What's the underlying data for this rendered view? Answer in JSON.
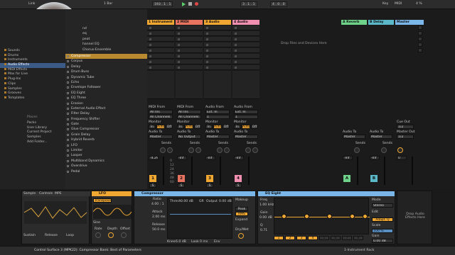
{
  "transport": {
    "link": "Link",
    "bpm_label": "1 Bar",
    "pos": "193 . 1 . 1",
    "pos2": "3 . 1 . 1",
    "end": "4 . 0 . 0",
    "key": "Key",
    "midi": "MIDI",
    "cpu": "4 %"
  },
  "browser": {
    "categories": [
      {
        "label": "Sounds",
        "color": "#b07a2e"
      },
      {
        "label": "Drums",
        "color": "#b07a2e"
      },
      {
        "label": "Instruments",
        "color": "#b07a2e"
      },
      {
        "label": "Audio Effects",
        "color": "#b07a2e"
      },
      {
        "label": "MIDI Effects",
        "color": "#b07a2e"
      },
      {
        "label": "Max for Live",
        "color": "#b07a2e"
      },
      {
        "label": "Plug-Ins",
        "color": "#b07a2e"
      },
      {
        "label": "Clips",
        "color": "#b07a2e"
      },
      {
        "label": "Samples",
        "color": "#b07a2e"
      },
      {
        "label": "Grooves",
        "color": "#b07a2e"
      },
      {
        "label": "Templates",
        "color": "#b07a2e"
      }
    ],
    "selected_category": 3,
    "places_title": "Places",
    "places": [
      "Packs",
      "User Library",
      "Current Project",
      "Samples",
      "Add Folder..."
    ],
    "items_top": [
      "nd",
      "eq",
      "peat",
      "hannel EQ",
      "Chorus-Ensemble"
    ],
    "items": [
      "Compressor",
      "Corpus",
      "Delay",
      "Drum Buss",
      "Dynamic Tube",
      "Echo",
      "Envelope Follower",
      "EQ Eight",
      "EQ Three",
      "Erosion",
      "External Audio Effect",
      "Filter Delay",
      "Frequency Shifter",
      "Gate",
      "Glue Compressor",
      "Grain Delay",
      "Hybrid Reverb",
      "LFO",
      "Limiter",
      "Looper",
      "Multiband Dynamics",
      "Overdrive",
      "Pedal"
    ],
    "selected_item": 0
  },
  "tracks": [
    {
      "name": "1 Instrument",
      "color": "#f0a832"
    },
    {
      "name": "2 MIDI",
      "color": "#e8735e"
    },
    {
      "name": "3 Audio",
      "color": "#f0a832"
    },
    {
      "name": "4 Audio",
      "color": "#f08fb0"
    }
  ],
  "returns": [
    {
      "name": "A Reverb",
      "color": "#6fd28a"
    },
    {
      "name": "B Delay",
      "color": "#5ab8c8"
    }
  ],
  "master": {
    "name": "Master",
    "color": "#7ab6e8"
  },
  "drop_hint": "Drop Files and Devices Here",
  "io": {
    "midi_from": "MIDI From",
    "audio_from": "Audio From",
    "all_ins": "All Ins",
    "all_channels": "All Channels",
    "ext_in": "Ext. In",
    "ch1": "1",
    "monitor": "Monitor",
    "mon_in": "In",
    "mon_auto": "Auto",
    "mon_off": "Off",
    "audio_to": "Audio To",
    "master": "Master",
    "no_output": "No Output",
    "sends": "Sends",
    "cue_out": "Cue Out",
    "cue_val": "1/2",
    "master_out": "Master Out",
    "master_val": "1/2"
  },
  "mixer": {
    "vols": [
      "-4.29",
      "-Inf",
      "-Inf",
      "-Inf"
    ],
    "scale": [
      "0",
      "12",
      "24",
      "36",
      "48",
      "60"
    ],
    "ret_vols": [
      "-Inf",
      "-Inf"
    ],
    "master_vol": "0",
    "nums": [
      "1",
      "2",
      "3",
      "4"
    ],
    "ret_letters": [
      "A",
      "B"
    ],
    "solo": "S",
    "cue": "C"
  },
  "detail": {
    "tabs": [
      "Sample",
      "Controls",
      "MPE"
    ],
    "sample_vals": [
      "Sustain",
      "Release",
      "Loop"
    ],
    "lfo": {
      "name": "LFO",
      "map": "Transpose",
      "sine": "Sine",
      "rate": "Rate",
      "depth": "Depth",
      "offset": "Offset",
      "rate_val": "1.00 Hz",
      "depth_val": "100 %",
      "offset_val": "0.00 %"
    },
    "comp": {
      "name": "Compressor",
      "thresh_lbl": "Thresh",
      "thresh_val": "0.00 dB",
      "gr_lbl": "GR",
      "output_lbl": "Output",
      "out_val": "0.00 dB",
      "ratio": "Ratio",
      "ratio_val": "4.00 : 1",
      "attack": "Attack",
      "attack_val": "2.00 ms",
      "release": "Release",
      "release_val": "50.0 ms",
      "knee": "Knee",
      "knee_val": "6.0 dB",
      "look": "Look",
      "look_val": "0 ms",
      "env": "Env",
      "makeup": "Makeup",
      "peak": "Peak",
      "rms": "RMS",
      "expand": "Expand",
      "drywet": "Dry/Wet",
      "drywet_val": "100 %"
    },
    "eq": {
      "name": "EQ Eight",
      "freq": "Freq",
      "freq_val": "1.00 kHz",
      "gain": "Gain",
      "gain_val": "0.00 dB",
      "q": "Q",
      "q_val": "0.71",
      "mode": "Mode",
      "mode_val": "Stereo",
      "edit": "Edit",
      "adapt": "Adapt. Q",
      "scale": "Scale",
      "scale_val": "100 %",
      "out_gain": "Gain",
      "out_gain_val": "0.00 dB"
    },
    "drop_right": "Drop Audio Effects Here"
  },
  "status": {
    "text": "Control Surface 3 (MPK22): Compressor Bank: Best of Parameters",
    "right": "1-Instrument Rack"
  }
}
